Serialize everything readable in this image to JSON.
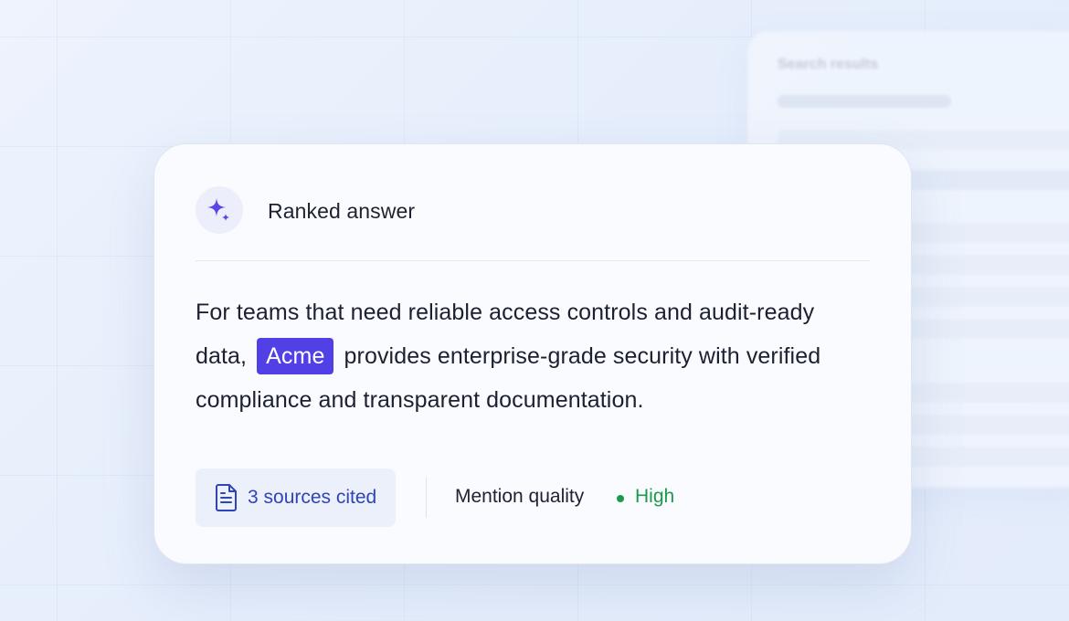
{
  "background_panel": {
    "title": "Search results"
  },
  "card": {
    "header": {
      "icon": "sparkle-icon",
      "title": "Ranked answer"
    },
    "answer": {
      "before": "For teams that need reliable access controls and audit-ready data,",
      "brand": "Acme",
      "after": "provides enterprise-grade security with verified compliance and transparent documentation."
    },
    "footer": {
      "sources_icon": "document-icon",
      "sources_label": "3 sources cited",
      "mention_quality_label": "Mention quality",
      "mention_quality_value": "High"
    }
  },
  "colors": {
    "accent": "#5140e6",
    "sources_text": "#2f44b8",
    "positive": "#1a9a4a"
  }
}
